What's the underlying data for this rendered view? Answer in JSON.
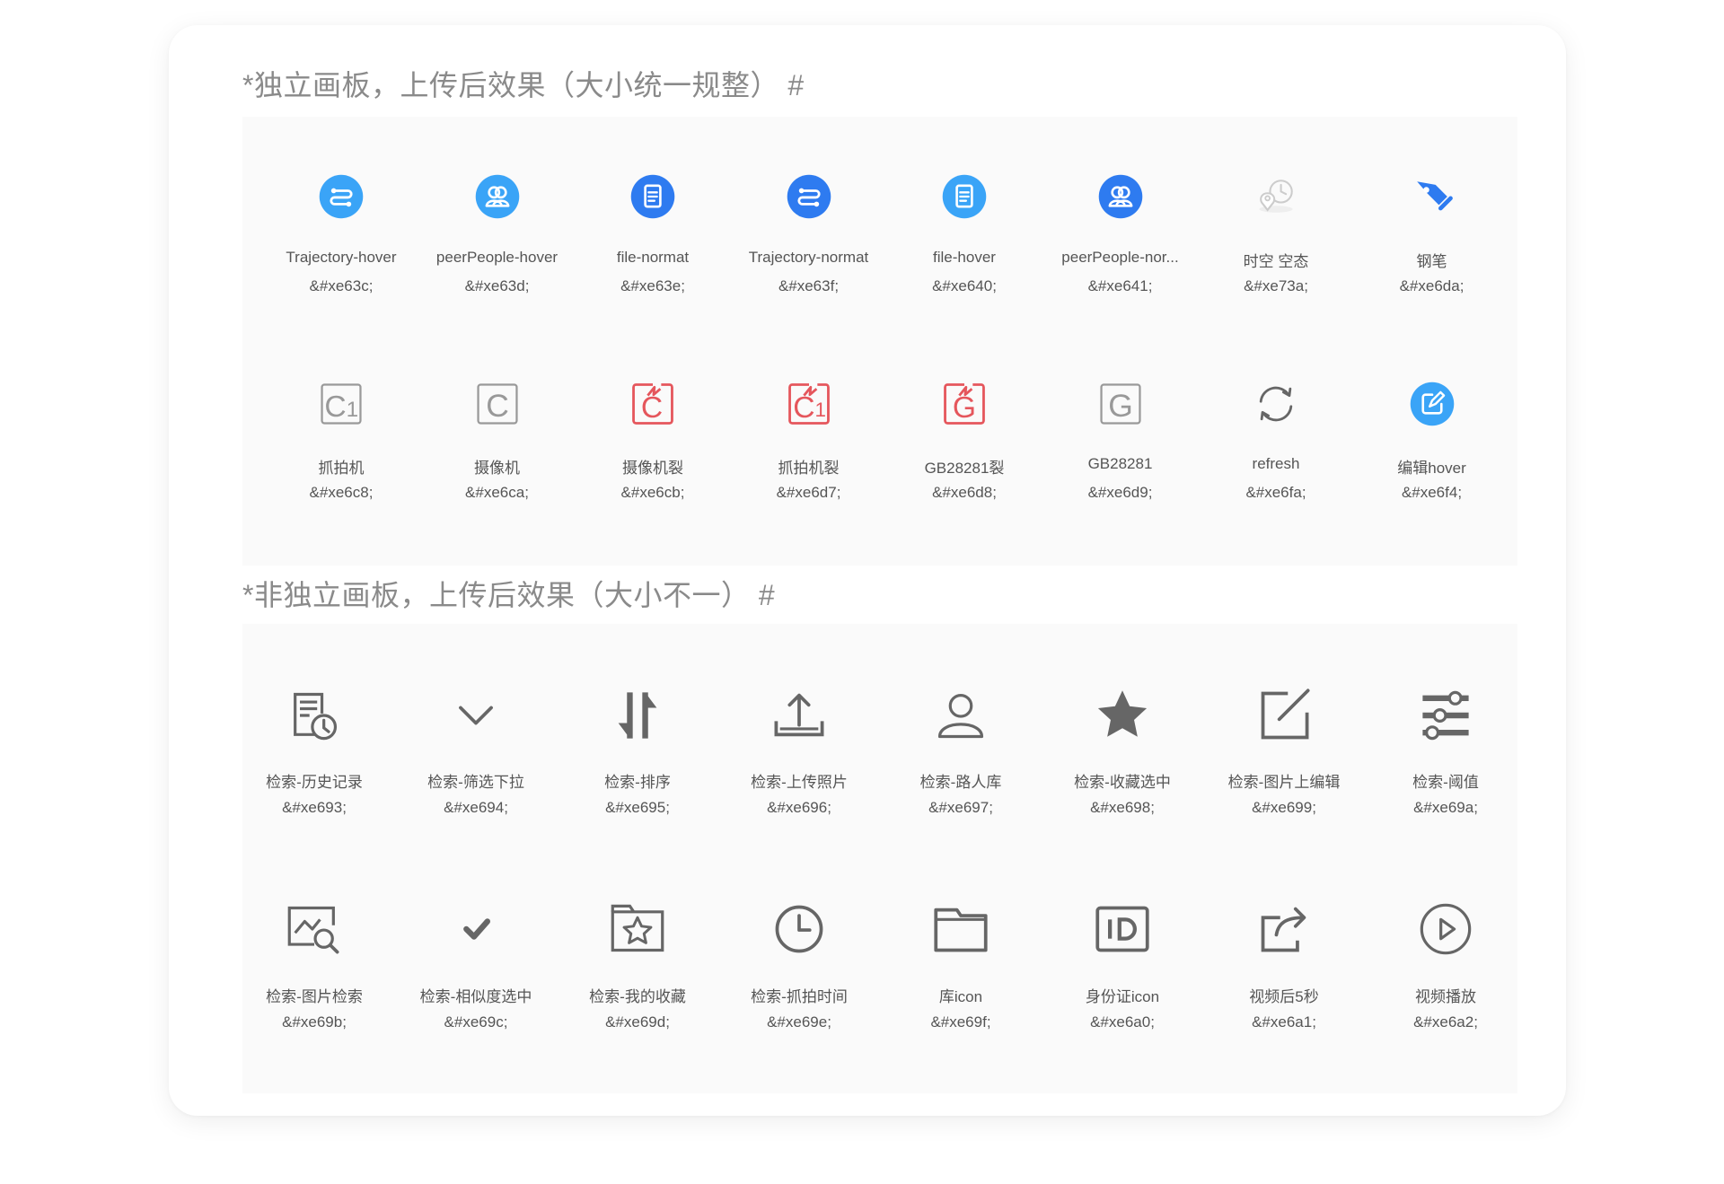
{
  "sections": [
    {
      "title": "*独立画板，上传后效果（大小统一规整） #",
      "items": [
        {
          "name": "Trajectory-hover",
          "code": "&#xe63c;",
          "icon": "trajectory-icon",
          "color": "#3aa4f7"
        },
        {
          "name": "peerPeople-hover",
          "code": "&#xe63d;",
          "icon": "peer-people-icon",
          "color": "#3aa4f7"
        },
        {
          "name": "file-normat",
          "code": "&#xe63e;",
          "icon": "file-icon",
          "color": "#2e7bf0"
        },
        {
          "name": "Trajectory-normat",
          "code": "&#xe63f;",
          "icon": "trajectory-icon",
          "color": "#2e7bf0"
        },
        {
          "name": "file-hover",
          "code": "&#xe640;",
          "icon": "file-icon",
          "color": "#3aa4f7"
        },
        {
          "name": "peerPeople-nor...",
          "code": "&#xe641;",
          "icon": "peer-people-icon",
          "color": "#2e7bf0"
        },
        {
          "name": "时空 空态",
          "code": "&#xe73a;",
          "icon": "time-space-empty-icon",
          "color": "#cccccc"
        },
        {
          "name": "钢笔",
          "code": "&#xe6da;",
          "icon": "pen-icon",
          "color": "#2e7bf0"
        },
        {
          "name": "抓拍机",
          "code": "&#xe6c8;",
          "icon": "snapshot-camera-icon",
          "color": "#999999"
        },
        {
          "name": "摄像机",
          "code": "&#xe6ca;",
          "icon": "camera-icon",
          "color": "#999999"
        },
        {
          "name": "摄像机裂",
          "code": "&#xe6cb;",
          "icon": "camera-broken-icon",
          "color": "#e5565c"
        },
        {
          "name": "抓拍机裂",
          "code": "&#xe6d7;",
          "icon": "snapshot-camera-broken-icon",
          "color": "#e5565c"
        },
        {
          "name": "GB28281裂",
          "code": "&#xe6d8;",
          "icon": "gb28281-broken-icon",
          "color": "#e5565c"
        },
        {
          "name": "GB28281",
          "code": "&#xe6d9;",
          "icon": "gb28281-icon",
          "color": "#999999"
        },
        {
          "name": "refresh",
          "code": "&#xe6fa;",
          "icon": "refresh-icon",
          "color": "#666666"
        },
        {
          "name": "编辑hover",
          "code": "&#xe6f4;",
          "icon": "edit-hover-icon",
          "color": "#3aa4f7"
        }
      ]
    },
    {
      "title": "*非独立画板，上传后效果（大小不一） #",
      "items": [
        {
          "name": "检索-历史记录",
          "code": "&#xe693;",
          "icon": "history-record-icon",
          "color": "#666666"
        },
        {
          "name": "检索-筛选下拉",
          "code": "&#xe694;",
          "icon": "chevron-down-icon",
          "color": "#666666"
        },
        {
          "name": "检索-排序",
          "code": "&#xe695;",
          "icon": "sort-icon",
          "color": "#666666"
        },
        {
          "name": "检索-上传照片",
          "code": "&#xe696;",
          "icon": "upload-photo-icon",
          "color": "#666666"
        },
        {
          "name": "检索-路人库",
          "code": "&#xe697;",
          "icon": "person-library-icon",
          "color": "#666666"
        },
        {
          "name": "检索-收藏选中",
          "code": "&#xe698;",
          "icon": "star-filled-icon",
          "color": "#666666"
        },
        {
          "name": "检索-图片上编辑",
          "code": "&#xe699;",
          "icon": "image-edit-icon",
          "color": "#666666"
        },
        {
          "name": "检索-阈值",
          "code": "&#xe69a;",
          "icon": "threshold-sliders-icon",
          "color": "#666666"
        },
        {
          "name": "检索-图片检索",
          "code": "&#xe69b;",
          "icon": "image-search-icon",
          "color": "#666666"
        },
        {
          "name": "检索-相似度选中",
          "code": "&#xe69c;",
          "icon": "check-icon",
          "color": "#666666"
        },
        {
          "name": "检索-我的收藏",
          "code": "&#xe69d;",
          "icon": "my-favorites-folder-icon",
          "color": "#666666"
        },
        {
          "name": "检索-抓拍时间",
          "code": "&#xe69e;",
          "icon": "clock-icon",
          "color": "#666666"
        },
        {
          "name": "库icon",
          "code": "&#xe69f;",
          "icon": "folder-icon",
          "color": "#666666"
        },
        {
          "name": "身份证icon",
          "code": "&#xe6a0;",
          "icon": "id-card-icon",
          "color": "#666666"
        },
        {
          "name": "视频后5秒",
          "code": "&#xe6a1;",
          "icon": "share-forward-icon",
          "color": "#666666"
        },
        {
          "name": "视频播放",
          "code": "&#xe6a2;",
          "icon": "play-circle-icon",
          "color": "#666666"
        }
      ]
    }
  ]
}
